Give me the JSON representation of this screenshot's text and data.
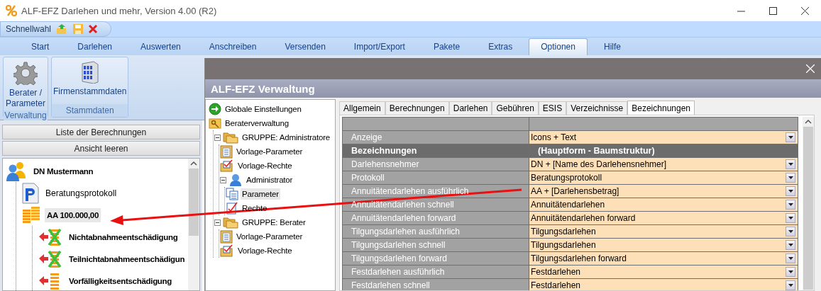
{
  "window": {
    "title": "ALF-EFZ Darlehen und mehr, Version 4.00 (R2)"
  },
  "quick_access": {
    "label": "Schnellwahl"
  },
  "ribbon_tabs": [
    {
      "label": "Start",
      "selected": false
    },
    {
      "label": "Darlehen",
      "selected": false
    },
    {
      "label": "Auswerten",
      "selected": false
    },
    {
      "label": "Anschreiben",
      "selected": false
    },
    {
      "label": "Versenden",
      "selected": false
    },
    {
      "label": "Import/Export",
      "selected": false
    },
    {
      "label": "Pakete",
      "selected": false
    },
    {
      "label": "Extras",
      "selected": false
    },
    {
      "label": "Optionen",
      "selected": true
    },
    {
      "label": "Hilfe",
      "selected": false
    }
  ],
  "ribbon_groups": [
    {
      "caption": "Verwaltung",
      "buttons": [
        {
          "label": "Berater / Parameter",
          "kind": "gear"
        }
      ]
    },
    {
      "caption": "Stammdaten",
      "buttons": [
        {
          "label": "Firmenstammdaten",
          "kind": "building"
        }
      ]
    }
  ],
  "left_pane": {
    "buttons": [
      "Liste der Berechnungen",
      "Ansicht leeren"
    ],
    "tree": [
      {
        "label": "DN Mustermann",
        "kind": "borrower",
        "selected": false,
        "children": [
          {
            "label": "Beratungsprotokoll",
            "kind": "protocol",
            "selected": false
          },
          {
            "label": "AA 100.000,00",
            "kind": "loan",
            "selected": true,
            "children": [
              {
                "label": "Nichtabnahmeentschädigung",
                "kind": "penalty_cancelled",
                "selected": false
              },
              {
                "label": "Teilnichtabnahmeentschädigun",
                "kind": "penalty_cancelled",
                "selected": false
              },
              {
                "label": "Vorfälligkeitsentschädigung",
                "kind": "penalty",
                "selected": false
              }
            ]
          }
        ]
      }
    ]
  },
  "dialog": {
    "title": "ALF-EFZ Verwaltung",
    "tree": [
      {
        "label": "Globale Einstellungen",
        "kind": "settings",
        "selected": false
      },
      {
        "label": "Beraterverwaltung",
        "kind": "admin",
        "selected": false,
        "children": [
          {
            "label": "GRUPPE: Administratore",
            "kind": "group",
            "expanded": true,
            "selected": false,
            "children": [
              {
                "label": "Vorlage-Parameter",
                "kind": "template_params",
                "selected": false
              },
              {
                "label": "Vorlage-Rechte",
                "kind": "template_rights",
                "selected": false
              },
              {
                "label": "Administrator",
                "kind": "user",
                "expanded": true,
                "selected": false,
                "children": [
                  {
                    "label": "Parameter",
                    "kind": "params",
                    "selected": true
                  },
                  {
                    "label": "Rechte",
                    "kind": "rights",
                    "selected": false
                  }
                ]
              }
            ]
          },
          {
            "label": "GRUPPE: Berater",
            "kind": "group",
            "expanded": true,
            "selected": false,
            "children": [
              {
                "label": "Vorlage-Parameter",
                "kind": "template_params",
                "selected": false
              },
              {
                "label": "Vorlage-Rechte",
                "kind": "template_rights",
                "selected": false
              }
            ]
          }
        ]
      }
    ],
    "tabs": [
      {
        "label": "Allgemein",
        "selected": false
      },
      {
        "label": "Berechnungen",
        "selected": false
      },
      {
        "label": "Darlehen",
        "selected": false
      },
      {
        "label": "Gebühren",
        "selected": false
      },
      {
        "label": "ESIS",
        "selected": false
      },
      {
        "label": "Verzeichnisse",
        "selected": false
      },
      {
        "label": "Bezeichnungen",
        "selected": true
      }
    ],
    "grid_rows": [
      {
        "kind": "setting",
        "label": "Anzeige",
        "value": "Icons + Text"
      },
      {
        "kind": "section",
        "label": "Bezeichnungen",
        "value": "(Hauptform - Baumstruktur)"
      },
      {
        "kind": "setting",
        "label": "Darlehensnehmer",
        "value": "DN + [Name des Darlehensnehmer]"
      },
      {
        "kind": "setting",
        "label": "Protokoll",
        "value": "Beratungsprotokoll"
      },
      {
        "kind": "setting",
        "label": "Annuitätendarlehen ausführlich",
        "value": "AA + [Darlehensbetrag]"
      },
      {
        "kind": "setting",
        "label": "Annuitätendarlehen schnell",
        "value": "Annuitätendarlehen"
      },
      {
        "kind": "setting",
        "label": "Annuitätendarlehen forward",
        "value": "Annuitätendarlehen forward"
      },
      {
        "kind": "setting",
        "label": "Tilgungsdarlehen ausführlich",
        "value": "Tilgungsdarlehen"
      },
      {
        "kind": "setting",
        "label": "Tilgungsdarlehen schnell",
        "value": "Tilgungsdarlehen"
      },
      {
        "kind": "setting",
        "label": "Tilgungsdarlehen forward",
        "value": "Tilgungsdarlehen forward"
      },
      {
        "kind": "setting",
        "label": "Festdarlehen ausführlich",
        "value": "Festdarlehen"
      },
      {
        "kind": "setting",
        "label": "Festdarlehen schnell",
        "value": "Festdarlehen"
      }
    ]
  }
}
